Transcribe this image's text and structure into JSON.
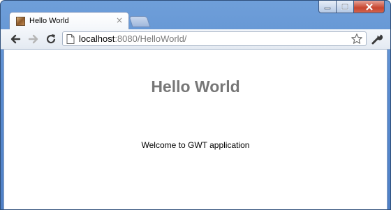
{
  "window": {
    "controls": {
      "minimize": "minimize-icon",
      "maximize": "maximize-icon",
      "close": "close-icon"
    }
  },
  "tab": {
    "title": "Hello World",
    "close_glyph": "×",
    "favicon": "gwt-favicon"
  },
  "toolbar": {
    "url_host": "localhost",
    "url_rest": ":8080/HelloWorld/",
    "icons": [
      "back-arrow-icon",
      "forward-arrow-icon",
      "reload-icon",
      "page-icon",
      "bookmark-star-icon",
      "wrench-icon"
    ]
  },
  "page": {
    "heading": "Hello World",
    "message": "Welcome to GWT application"
  },
  "colors": {
    "heading": "#777777",
    "frame": "#5a8cd0"
  }
}
